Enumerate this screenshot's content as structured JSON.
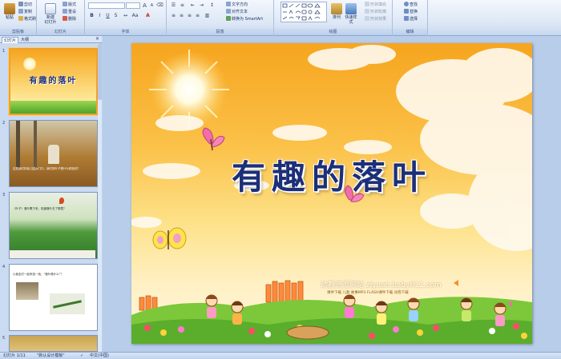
{
  "ribbon": {
    "clipboard": {
      "paste": "粘贴",
      "cut": "剪切",
      "copy": "复制",
      "format_painter": "格式刷",
      "label": "剪贴板"
    },
    "slides": {
      "new_slide": "新建\n幻灯片",
      "layout": "版式",
      "reset": "重设",
      "delete": "删除",
      "label": "幻灯片"
    },
    "font": {
      "font_name": "",
      "font_size": "",
      "label": "字体"
    },
    "paragraph": {
      "text_direction": "文字方向",
      "align_text": "对齐文本",
      "convert_smartart": "转换为 SmartArt",
      "label": "段落"
    },
    "drawing": {
      "arrange": "排列",
      "quick_styles": "快速样式",
      "shape_fill": "形状填充",
      "shape_outline": "形状轮廓",
      "shape_effects": "形状效果",
      "label": "绘图"
    },
    "editing": {
      "find": "查找",
      "replace": "替换",
      "select": "选择",
      "label": "编辑"
    }
  },
  "panel": {
    "tabs": [
      "幻灯片",
      "大纲"
    ],
    "slides": [
      {
        "num": "1",
        "title": "有趣的落叶"
      },
      {
        "num": "2",
        "text": "这是我们的幼儿园大门口，我们的叶子是什么颜色的？"
      },
      {
        "num": "3",
        "text": "（叶子）落叶飘下来，知道落叶去了哪里？"
      },
      {
        "num": "4",
        "text": "小朋友们一起来找一找，\"落叶像什么\"？"
      },
      {
        "num": "5",
        "text": ""
      }
    ]
  },
  "slide": {
    "title": "有趣的落叶",
    "site_line": "幼教资源网站  ziyuan.baby611.com",
    "site_sub": "课件下载   儿歌   故事MP3   FLASH课件下载   试卷下载"
  },
  "status": {
    "slide_count": "幻灯片 1/11",
    "theme": "\"默认设计模板\"",
    "language": "中文(中国)"
  }
}
